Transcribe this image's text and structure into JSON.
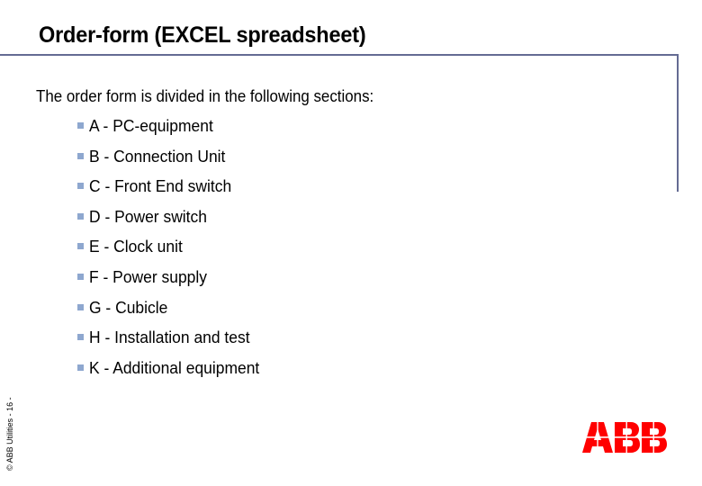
{
  "slide": {
    "title": "Order-form (EXCEL spreadsheet)",
    "intro": "The order form is divided in the following sections:",
    "sections": [
      {
        "label": "A - PC-equipment"
      },
      {
        "label": "B - Connection Unit"
      },
      {
        "label": "C - Front End switch"
      },
      {
        "label": "D - Power switch"
      },
      {
        "label": "E - Clock unit"
      },
      {
        "label": "F - Power supply"
      },
      {
        "label": "G - Cubicle"
      },
      {
        "label": "H - Installation and test"
      },
      {
        "label": "K - Additional equipment"
      }
    ],
    "footer": "© ABB Utilities  - 16 -",
    "logo": {
      "text": "ABB",
      "color": "#ff0000",
      "icon": "abb-logo-icon"
    }
  },
  "colors": {
    "frame_line": "#646b93",
    "bullet": "#8ea7cf",
    "text": "#000000",
    "background": "#ffffff"
  }
}
